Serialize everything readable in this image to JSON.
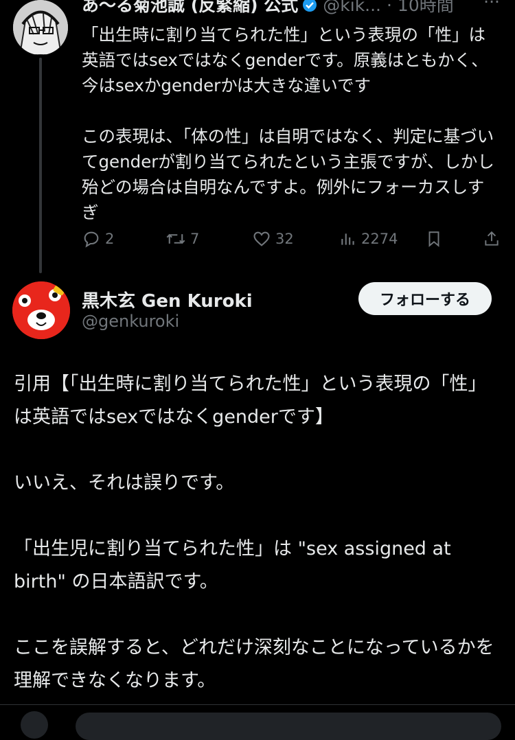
{
  "quoted_tweet": {
    "author_name": "あ～る菊池誠 (反緊縮) 公式",
    "handle": "@kik...",
    "time": "· 10時間",
    "more": "···",
    "paragraphs": [
      "「出生時に割り当てられた性」という表現の「性」は英語ではsexではなくgenderです。原義はともかく、今はsexかgenderかは大きな違いです",
      "この表現は、「体の性」は自明ではなく、判定に基づいてgenderが割り当てられたという主張ですが、しかし殆どの場合は自明なんですよ。例外にフォーカスしすぎ"
    ],
    "actions": {
      "replies": "2",
      "reposts": "7",
      "likes": "32",
      "views": "2274"
    }
  },
  "main_tweet": {
    "author_name": "黒木玄 Gen Kuroki",
    "handle": "@genkuroki",
    "follow_label": "フォローする",
    "paragraphs": [
      "引用【「出生時に割り当てられた性」という表現の「性」は英語ではsexではなくgenderです】",
      "いいえ、それは誤りです。",
      "「出生児に割り当てられた性」は \"sex assigned at birth\" の日本語訳です。",
      "ここを誤解すると、どれだけ深刻なことになっているかを理解できなくなります。"
    ]
  },
  "colors": {
    "background": "#000000",
    "text": "#e7e9ea",
    "secondary": "#71767b",
    "verified": "#1d9bf0",
    "avatar_red": "#e8261c"
  }
}
